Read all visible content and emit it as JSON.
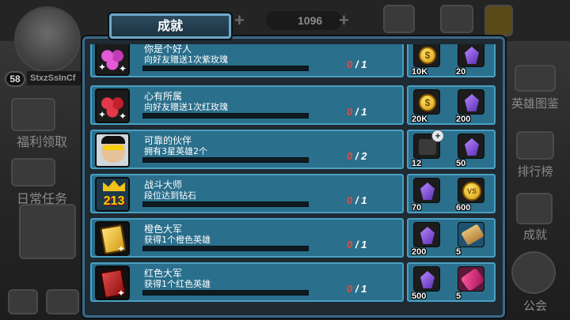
{
  "hud": {
    "player_level": "58",
    "player_name": "StxzSsInCf",
    "gem_count": "1096",
    "plus_symbol": "+"
  },
  "left_menu": [
    {
      "label": "福利领取"
    },
    {
      "label": "日常任务"
    }
  ],
  "right_menu": [
    {
      "label": "英雄图鉴"
    },
    {
      "label": "排行榜"
    },
    {
      "label": "成就"
    },
    {
      "label": "公会"
    }
  ],
  "panel": {
    "title": "成就"
  },
  "achievements": [
    {
      "name": "你是个好人",
      "desc": "向好友赠送1次紫玫瑰",
      "current": "0",
      "total": "1",
      "progress": 0,
      "icon": "purple-roses-icon",
      "rewards": [
        {
          "icon": "gold-coin-icon",
          "amount": "10K"
        },
        {
          "icon": "purple-gem-icon",
          "amount": "20"
        }
      ]
    },
    {
      "name": "心有所属",
      "desc": "向好友赠送1次红玫瑰",
      "current": "0",
      "total": "1",
      "progress": 0,
      "icon": "red-roses-icon",
      "rewards": [
        {
          "icon": "gold-coin-icon",
          "amount": "20K"
        },
        {
          "icon": "purple-gem-icon",
          "amount": "200"
        }
      ]
    },
    {
      "name": "可靠的伙伴",
      "desc": "拥有3星英雄2个",
      "current": "0",
      "total": "2",
      "progress": 0,
      "icon": "hero-face-icon",
      "rewards": [
        {
          "icon": "hero-card-icon",
          "amount": "12"
        },
        {
          "icon": "purple-gem-icon",
          "amount": "50"
        }
      ]
    },
    {
      "name": "战斗大师",
      "desc": "段位达到钻石",
      "current": "0",
      "total": "1",
      "progress": 0,
      "icon": "crown-podium-icon",
      "rewards": [
        {
          "icon": "purple-gem-icon",
          "amount": "70"
        },
        {
          "icon": "vs-coin-icon",
          "amount": "600",
          "coin_text": "VS"
        }
      ]
    },
    {
      "name": "橙色大军",
      "desc": "获得1个橙色英雄",
      "current": "0",
      "total": "1",
      "progress": 0,
      "icon": "orange-card-icon",
      "rewards": [
        {
          "icon": "purple-gem-icon",
          "amount": "200"
        },
        {
          "icon": "scroll-icon",
          "amount": "5"
        }
      ]
    },
    {
      "name": "红色大军",
      "desc": "获得1个红色英雄",
      "current": "0",
      "total": "1",
      "progress": 0,
      "icon": "red-card-icon",
      "rewards": [
        {
          "icon": "purple-gem-icon",
          "amount": "500"
        },
        {
          "icon": "rocket-icon",
          "amount": "5"
        }
      ]
    }
  ],
  "colors": {
    "row_bg": "#2a6f8c",
    "row_border": "#4aa0c2",
    "progress_current": "#e84a3a",
    "panel_border": "#3b6a86"
  }
}
